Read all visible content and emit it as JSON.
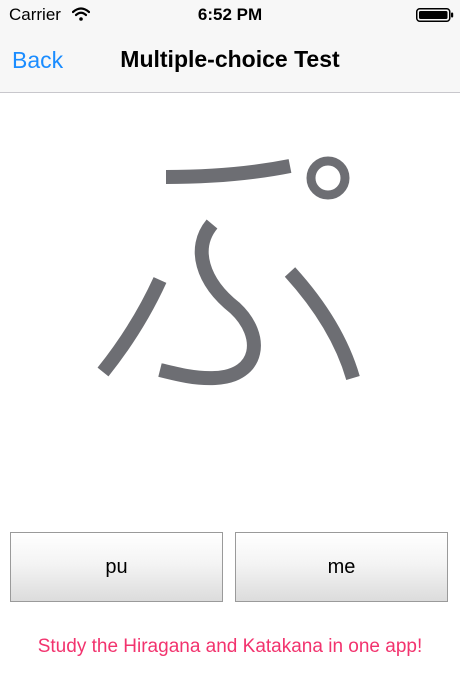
{
  "status_bar": {
    "carrier": "Carrier",
    "time": "6:52 PM",
    "wifi_icon": "wifi-icon",
    "battery_icon": "battery-icon"
  },
  "nav": {
    "back_label": "Back",
    "title": "Multiple-choice Test"
  },
  "question": {
    "character": "ぷ",
    "glyph_color": "#6d6e73"
  },
  "answers": [
    {
      "label": "pu"
    },
    {
      "label": "me"
    }
  ],
  "promo_text": "Study the Hiragana and Katakana in one app!",
  "colors": {
    "accent": "#1a8cff",
    "promo": "#f2336e",
    "bar_background": "#f7f7f7"
  }
}
